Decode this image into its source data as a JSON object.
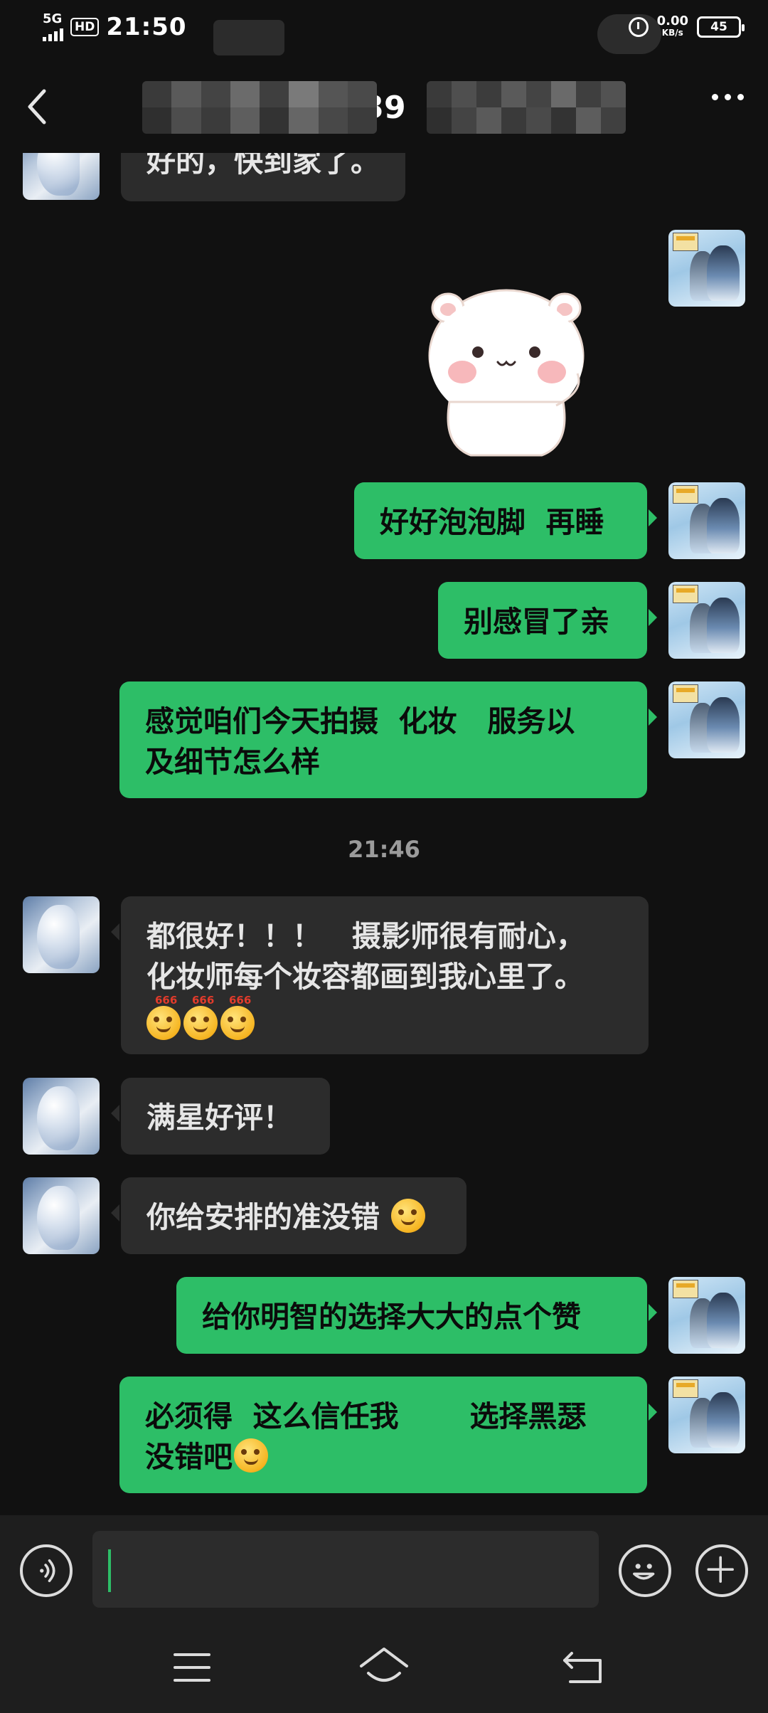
{
  "status_bar": {
    "network": "5G",
    "hd": "HD",
    "time": "21:50",
    "speed_value": "0.00",
    "speed_unit": "KB/s",
    "battery": "45"
  },
  "header": {
    "title_visible": "39"
  },
  "messages": [
    {
      "side": "in",
      "text": "好的，快到家了。"
    },
    {
      "side": "out",
      "type": "sticker",
      "icon": "white-bear-sticker"
    },
    {
      "side": "out",
      "text": "好好泡泡脚  再睡"
    },
    {
      "side": "out",
      "text": "别感冒了亲"
    },
    {
      "side": "out",
      "lines": [
        "感觉咱们今天拍摄  化妆   服务以",
        "及细节怎么样"
      ]
    },
    {
      "type": "timestamp",
      "text": "21:46"
    },
    {
      "side": "in",
      "lines": [
        "都很好！！！   摄影师很有耐心，",
        "化妆师每个妆容都画到我心里了。"
      ],
      "emoji_label": "666",
      "emoji_count": 3
    },
    {
      "side": "in",
      "text": "满星好评！"
    },
    {
      "side": "in",
      "text": "你给安排的准没错",
      "emoji": "ok-hand-emoji"
    },
    {
      "side": "out",
      "text": "给你明智的选择大大的点个赞"
    },
    {
      "side": "out",
      "lines": [
        "必须得  这么信任我       选择黑瑟",
        "没错吧"
      ],
      "emoji": "wink-tongue-emoji"
    }
  ],
  "input": {
    "value": "",
    "placeholder": ""
  },
  "colors": {
    "background": "#111111",
    "outgoing_bubble": "#2dbe67",
    "incoming_bubble": "#2c2c2c",
    "caret": "#2dbe67"
  },
  "icons": {
    "back": "chevron-left-icon",
    "more": "more-dots-icon",
    "voice": "voice-icon",
    "emoji": "smiley-icon",
    "add": "plus-icon",
    "menu": "menu-lines-icon",
    "home": "home-icon",
    "back_nav": "return-icon"
  }
}
